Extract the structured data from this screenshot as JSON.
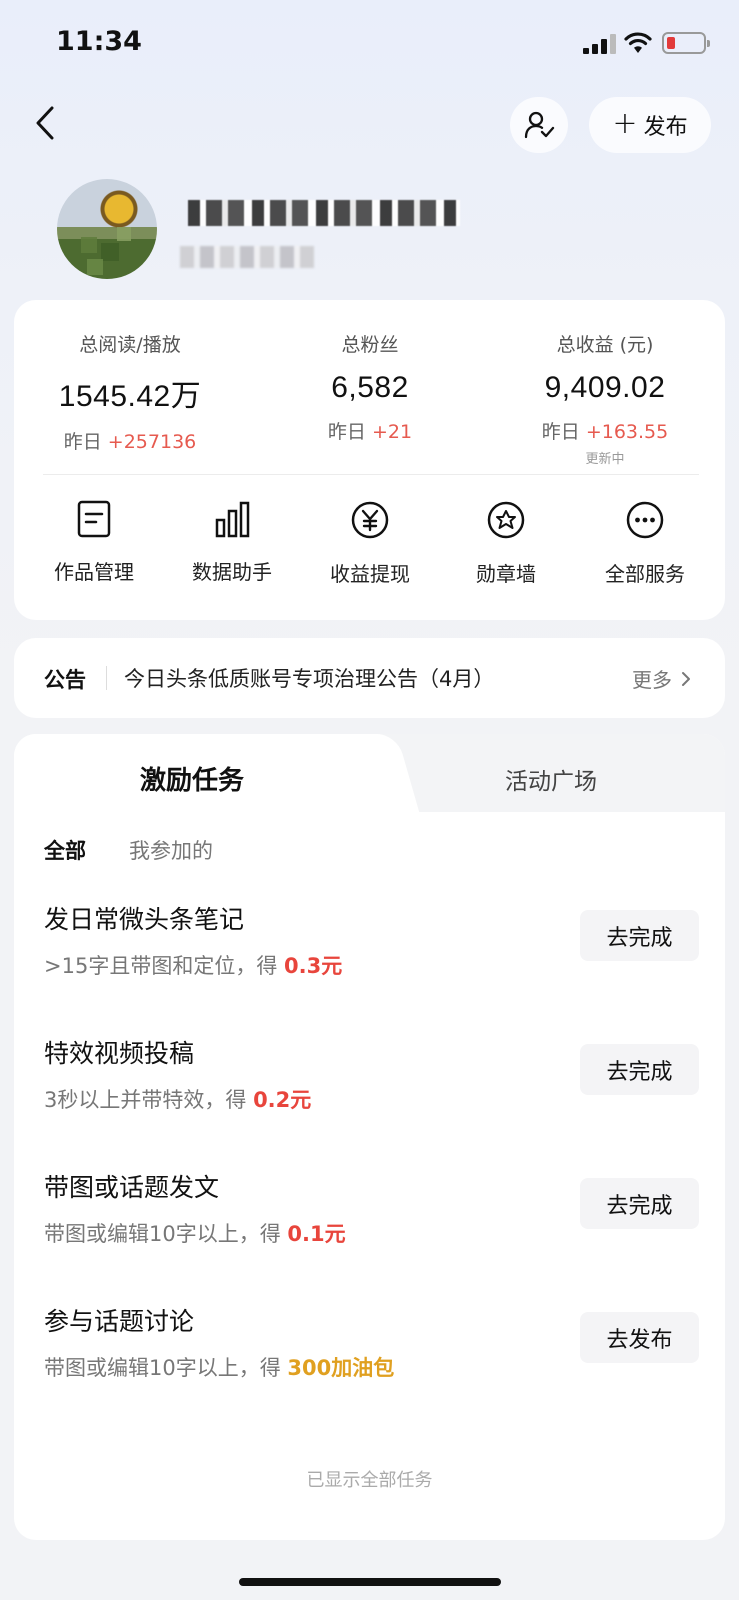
{
  "status_bar": {
    "time": "11:34"
  },
  "header": {
    "publish_label": "发布"
  },
  "stats": [
    {
      "label": "总阅读/播放",
      "value": "1545.42万",
      "delta_prefix": "昨日",
      "delta": "+257136"
    },
    {
      "label": "总粉丝",
      "value": "6,582",
      "delta_prefix": "昨日",
      "delta": "+21"
    },
    {
      "label": "总收益 (元)",
      "value": "9,409.02",
      "delta_prefix": "昨日",
      "delta": "+163.55",
      "note": "更新中"
    }
  ],
  "services": [
    {
      "label": "作品管理",
      "icon": "document-icon"
    },
    {
      "label": "数据助手",
      "icon": "bar-chart-icon"
    },
    {
      "label": "收益提现",
      "icon": "yuan-icon"
    },
    {
      "label": "勋章墙",
      "icon": "badge-icon"
    },
    {
      "label": "全部服务",
      "icon": "more-icon"
    }
  ],
  "notice": {
    "tag": "公告",
    "text": "今日头条低质账号专项治理公告（4月）",
    "more": "更多"
  },
  "tabs": {
    "active": "激励任务",
    "inactive": "活动广场"
  },
  "filters": {
    "all": "全部",
    "mine": "我参加的"
  },
  "tasks": [
    {
      "title": "发日常微头条笔记",
      "desc": ">15字且带图和定位，得",
      "reward": "0.3元",
      "reward_color": "#e8453c",
      "button": "去完成"
    },
    {
      "title": "特效视频投稿",
      "desc": "3秒以上并带特效，得",
      "reward": "0.2元",
      "reward_color": "#e8453c",
      "button": "去完成"
    },
    {
      "title": "带图或话题发文",
      "desc": "带图或编辑10字以上，得",
      "reward": "0.1元",
      "reward_color": "#e8453c",
      "button": "去完成"
    },
    {
      "title": "参与话题讨论",
      "desc": "带图或编辑10字以上，得",
      "reward": "300加油包",
      "reward_color": "#e0a020",
      "button": "去发布"
    }
  ],
  "footer_note": "已显示全部任务"
}
